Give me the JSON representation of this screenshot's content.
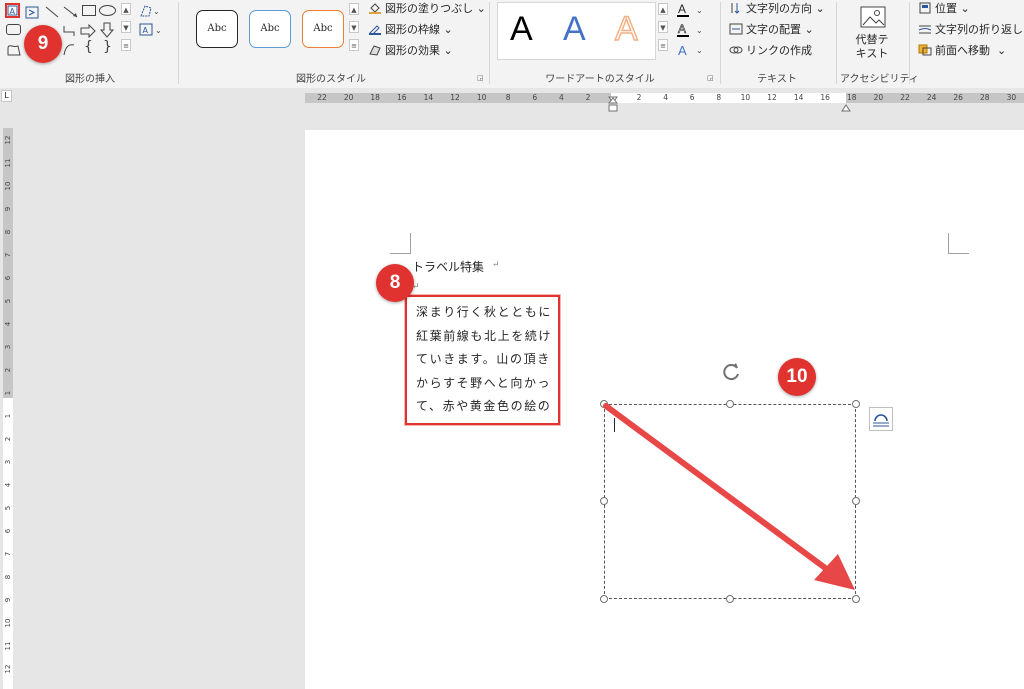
{
  "ribbon": {
    "groups": {
      "insert_shapes": "図形の挿入",
      "shape_styles": "図形のスタイル",
      "wordart_styles": "ワードアートのスタイル",
      "text": "テキスト",
      "accessibility": "アクセシビリティ"
    },
    "shape_style_samples": [
      "Abc",
      "Abc",
      "Abc"
    ],
    "shape_menu": {
      "fill": "図形の塗りつぶし",
      "outline": "図形の枠線",
      "effects": "図形の効果"
    },
    "wordart_samples": [
      "A",
      "A",
      "A"
    ],
    "text_menu": {
      "direction": "文字列の方向",
      "align": "文字の配置",
      "link": "リンクの作成"
    },
    "alt_text": {
      "line1": "代替テ",
      "line2": "キスト"
    },
    "arrange_menu": {
      "position": "位置",
      "wrap": "文字列の折り返し",
      "bring_forward": "前面へ移動"
    }
  },
  "ruler": {
    "horizontal_ticks": [
      "22",
      "20",
      "18",
      "16",
      "14",
      "12",
      "10",
      "8",
      "6",
      "4",
      "2",
      "2",
      "4",
      "6",
      "8",
      "10",
      "12",
      "14",
      "16",
      "18",
      "20",
      "22",
      "24",
      "26",
      "28",
      "30"
    ],
    "vertical_ticks": [
      "12",
      "11",
      "10",
      "9",
      "8",
      "7",
      "6",
      "5",
      "4",
      "3",
      "2",
      "1",
      "1",
      "2",
      "3",
      "4",
      "5",
      "6",
      "7",
      "8",
      "9",
      "10",
      "11",
      "12"
    ]
  },
  "document": {
    "heading": "トラベル特集",
    "textbox_lines": [
      "深まり行く秋とともに",
      "紅葉前線も北上を続け",
      "ていきます。山の頂き",
      "からすそ野へと向かっ",
      "て、赤や黄金色の絵の"
    ]
  },
  "annotations": {
    "step8": "8",
    "step9": "9",
    "step10": "10"
  },
  "colors": {
    "accent_red": "#e0322f",
    "wordart_black": "#000000",
    "wordart_blue": "#4472c4",
    "wordart_orange": "#f4b183",
    "style_blue": "#5b9bd5",
    "style_orange": "#ed7d31"
  }
}
